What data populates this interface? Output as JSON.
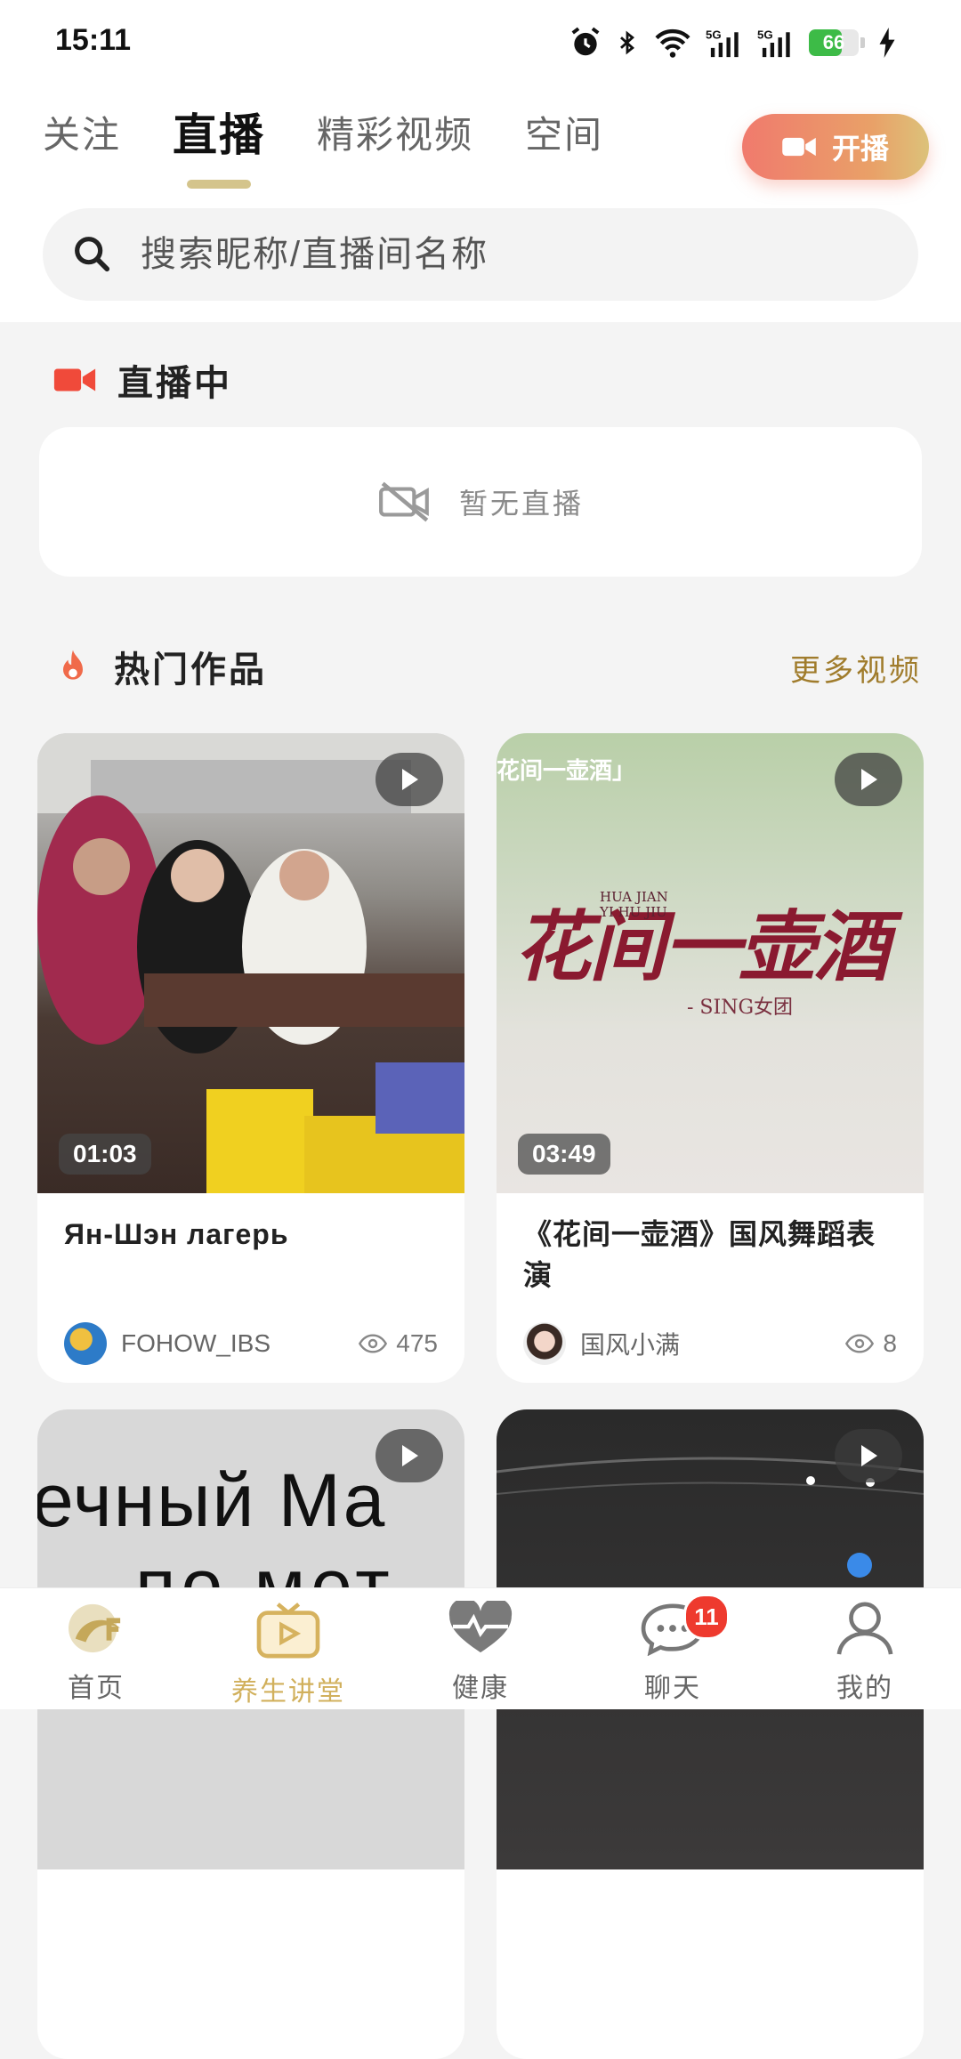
{
  "status_bar": {
    "time": "15:11",
    "battery_level": "66",
    "battery_fraction": 0.66,
    "network": [
      "5G",
      "5G"
    ]
  },
  "tabs": [
    {
      "label": "关注",
      "active": false
    },
    {
      "label": "直播",
      "active": true
    },
    {
      "label": "精彩视频",
      "active": false
    },
    {
      "label": "空间",
      "active": false
    }
  ],
  "go_live_button": "开播",
  "search": {
    "placeholder": "搜索昵称/直播间名称"
  },
  "live_section": {
    "title": "直播中",
    "empty_text": "暂无直播"
  },
  "hot_section": {
    "title": "热门作品",
    "more_label": "更多视频"
  },
  "videos": [
    {
      "title": "Ян-Шэн лагерь",
      "duration": "01:03",
      "author": "FOHOW_IBS",
      "views": "475"
    },
    {
      "title": "《花间一壶酒》国风舞蹈表演",
      "duration": "03:49",
      "author": "国风小满",
      "views": "8",
      "thumb_overlay_text": "花间一壶酒」",
      "thumb_art_text": "花间一壶酒",
      "thumb_caption_small": "HUA JIAN\nYI HU JIU",
      "thumb_caption": "- SING女团"
    },
    {
      "thumb_text_line1": "ечный Ма",
      "thumb_text_line2": "по мет"
    },
    {}
  ],
  "bottom_nav": [
    {
      "label": "首页",
      "icon": "fohow-logo-icon",
      "active": false
    },
    {
      "label": "养生讲堂",
      "icon": "tv-play-icon",
      "active": true
    },
    {
      "label": "健康",
      "icon": "heart-pulse-icon",
      "active": false
    },
    {
      "label": "聊天",
      "icon": "chat-bubble-icon",
      "active": false,
      "badge": "11"
    },
    {
      "label": "我的",
      "icon": "user-icon",
      "active": false
    }
  ],
  "colors": {
    "accent_gold": "#d4c48c",
    "live_red": "#f04a3a",
    "more_link": "#a07c2c",
    "badge_red": "#ee3a2e"
  }
}
